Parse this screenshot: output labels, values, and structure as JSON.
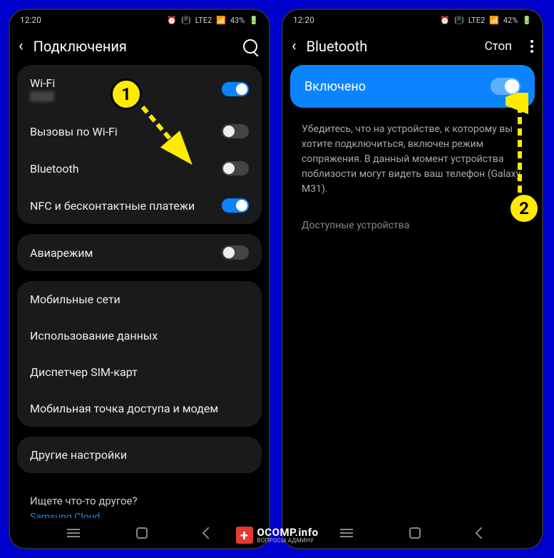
{
  "left": {
    "status": {
      "time": "12:20",
      "battery": "43%",
      "network": "LTE2"
    },
    "header": {
      "title": "Подключения"
    },
    "group1": {
      "wifi": {
        "label": "Wi-Fi",
        "sub": "████",
        "on": true
      },
      "wifi_call": {
        "label": "Вызовы по Wi-Fi",
        "on": false
      },
      "bluetooth": {
        "label": "Bluetooth",
        "on": false
      },
      "nfc": {
        "label": "NFC и бесконтактные платежи",
        "on": true
      }
    },
    "group2": {
      "airplane": {
        "label": "Авиарежим",
        "on": false
      }
    },
    "group3": {
      "mobile": {
        "label": "Мобильные сети"
      },
      "data": {
        "label": "Использование данных"
      },
      "sim": {
        "label": "Диспетчер SIM-карт"
      },
      "hotspot": {
        "label": "Мобильная точка доступа и модем"
      }
    },
    "group4": {
      "other": {
        "label": "Другие настройки"
      }
    },
    "footer": {
      "question": "Ищете что-то другое?",
      "link": "Samsung Cloud"
    }
  },
  "right": {
    "status": {
      "time": "12:20",
      "battery": "42%",
      "network": "LTE2"
    },
    "header": {
      "title": "Bluetooth",
      "action": "Стоп"
    },
    "enabled": {
      "label": "Включено"
    },
    "desc": "Убедитесь, что на устройстве, к которому вы хотите подключиться, включен режим сопряжения. В данный момент устройства поблизости могут видеть ваш телефон (Galaxy M31).",
    "section": "Доступные устройства"
  },
  "watermark": {
    "main": "OCOMP.info",
    "sub": "ВОПРОСЫ АДМИНУ"
  }
}
